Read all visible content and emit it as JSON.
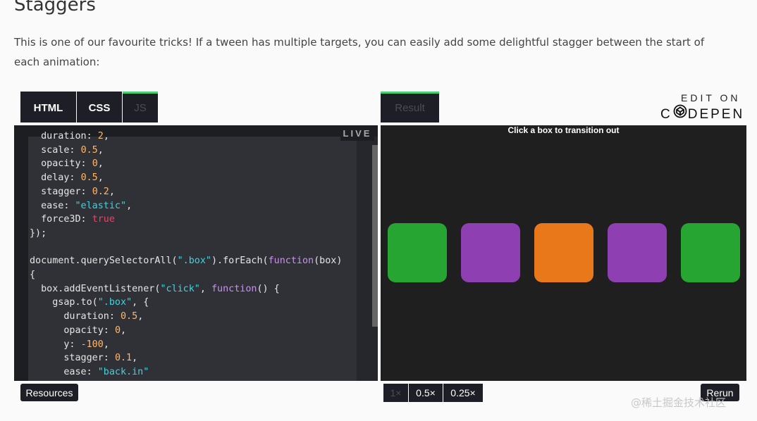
{
  "section": {
    "heading": "Staggers",
    "intro": "This is one of our favourite tricks! If a tween has multiple targets, you can easily add some delightful stagger between the start of each animation:"
  },
  "embed": {
    "tabs": {
      "html": "HTML",
      "css": "CSS",
      "js": "JS",
      "result": "Result"
    },
    "edit_on": "EDIT ON",
    "codepen": "CODEPEN",
    "live_badge": "LIVE",
    "result_hint": "Click a box to transition out",
    "boxes": [
      {
        "color": "#26a532"
      },
      {
        "color": "#8e3fb2"
      },
      {
        "color": "#e8781a"
      },
      {
        "color": "#8e3fb2"
      },
      {
        "color": "#26a532"
      }
    ],
    "resources_label": "Resources",
    "speeds": [
      "1×",
      "0.5×",
      "0.25×"
    ],
    "rerun_label": "Rerun"
  },
  "code": {
    "lines": [
      "  duration: 2,",
      "  scale: 0.5,",
      "  opacity: 0,",
      "  delay: 0.5,",
      "  stagger: 0.2,",
      "  ease: \"elastic\",",
      "  force3D: true",
      "});",
      "",
      "document.querySelectorAll(\".box\").forEach(function(box)",
      "{",
      "  box.addEventListener(\"click\", function() {",
      "    gsap.to(\".box\", {",
      "      duration: 0.5,",
      "      opacity: 0,",
      "      y: -100,",
      "      stagger: 0.1,",
      "      ease: \"back.in\""
    ]
  },
  "watermark": "@稀土掘金技术社区",
  "colors": {
    "editor_bg": "#1d1e22",
    "code_bg": "#2f3136",
    "tab_bg": "#1e1f26",
    "accent_green": "#47cf73"
  }
}
